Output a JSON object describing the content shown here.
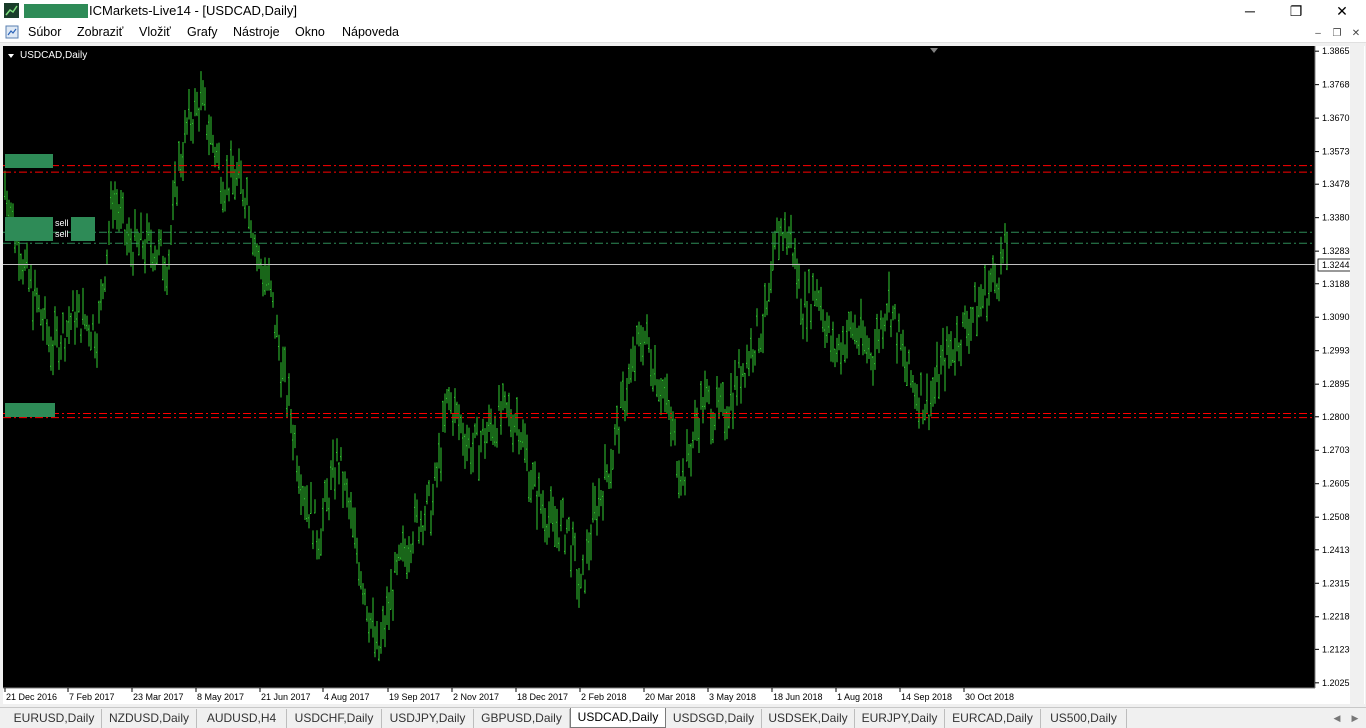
{
  "window": {
    "title": "ICMarkets-Live14 - [USDCAD,Daily]",
    "minimize_glyph": "─",
    "maximize_glyph": "❐",
    "close_glyph": "✕"
  },
  "menu": {
    "items": [
      "Súbor",
      "Zobraziť",
      "Vložiť",
      "Grafy",
      "Nástroje",
      "Okno",
      "Nápoveda"
    ],
    "mdi_minimize": "–",
    "mdi_restore": "❐",
    "mdi_close": "✕"
  },
  "chart": {
    "symbol_label": "USDCAD,Daily",
    "current_price": "1.32442",
    "colors": {
      "background": "#000000",
      "candles": "#32cd32",
      "grid_text": "#ffffff",
      "sell_lines": "#ff0000",
      "buy_lines": "#2e8b57",
      "price_line": "#c0c0c0",
      "label_box": "#2e8b57"
    },
    "order_labels": [
      "sell",
      "sell"
    ],
    "icons": [
      "chart-dropdown-arrow-icon",
      "app-logo-icon",
      "chart-window-icon"
    ]
  },
  "chart_data": {
    "type": "bar",
    "title": "USDCAD,Daily",
    "y_ticks": [
      "1.38655",
      "1.37680",
      "1.36705",
      "1.35730",
      "1.34780",
      "1.33805",
      "1.32830",
      "1.31880",
      "1.30905",
      "1.29930",
      "1.28955",
      "1.28005",
      "1.27030",
      "1.26055",
      "1.25080",
      "1.24130",
      "1.23155",
      "1.22180",
      "1.21230",
      "1.20255"
    ],
    "x_ticks": [
      "21 Dec 2016",
      "7 Feb 2017",
      "23 Mar 2017",
      "8 May 2017",
      "21 Jun 2017",
      "4 Aug 2017",
      "19 Sep 2017",
      "2 Nov 2017",
      "18 Dec 2017",
      "2 Feb 2018",
      "20 Mar 2018",
      "3 May 2018",
      "18 Jun 2018",
      "1 Aug 2018",
      "14 Sep 2018",
      "30 Oct 2018"
    ],
    "ylim": [
      1.2025,
      1.3866
    ],
    "path_points": [
      [
        0,
        1.35
      ],
      [
        25,
        1.32
      ],
      [
        50,
        1.3
      ],
      [
        72,
        1.31
      ],
      [
        95,
        1.305
      ],
      [
        110,
        1.345
      ],
      [
        125,
        1.33
      ],
      [
        150,
        1.33
      ],
      [
        165,
        1.325
      ],
      [
        175,
        1.352
      ],
      [
        185,
        1.365
      ],
      [
        198,
        1.372
      ],
      [
        210,
        1.36
      ],
      [
        222,
        1.348
      ],
      [
        232,
        1.35
      ],
      [
        245,
        1.345
      ],
      [
        255,
        1.325
      ],
      [
        265,
        1.32
      ],
      [
        280,
        1.293
      ],
      [
        300,
        1.26
      ],
      [
        315,
        1.245
      ],
      [
        335,
        1.268
      ],
      [
        355,
        1.24
      ],
      [
        375,
        1.21
      ],
      [
        390,
        1.23
      ],
      [
        410,
        1.248
      ],
      [
        430,
        1.255
      ],
      [
        445,
        1.285
      ],
      [
        470,
        1.27
      ],
      [
        495,
        1.28
      ],
      [
        515,
        1.28
      ],
      [
        530,
        1.26
      ],
      [
        550,
        1.248
      ],
      [
        565,
        1.248
      ],
      [
        578,
        1.228
      ],
      [
        590,
        1.25
      ],
      [
        610,
        1.27
      ],
      [
        625,
        1.29
      ],
      [
        640,
        1.305
      ],
      [
        660,
        1.288
      ],
      [
        680,
        1.262
      ],
      [
        700,
        1.285
      ],
      [
        720,
        1.28
      ],
      [
        740,
        1.295
      ],
      [
        765,
        1.31
      ],
      [
        775,
        1.335
      ],
      [
        788,
        1.332
      ],
      [
        800,
        1.312
      ],
      [
        815,
        1.318
      ],
      [
        830,
        1.298
      ],
      [
        850,
        1.306
      ],
      [
        870,
        1.298
      ],
      [
        885,
        1.315
      ],
      [
        905,
        1.292
      ],
      [
        925,
        1.283
      ],
      [
        940,
        1.296
      ],
      [
        960,
        1.305
      ],
      [
        980,
        1.315
      ],
      [
        995,
        1.322
      ],
      [
        1005,
        1.33
      ]
    ],
    "horizontal_lines": [
      {
        "name": "sell-line-1",
        "value": 1.3532,
        "color": "#ff0000"
      },
      {
        "name": "sell-line-2",
        "value": 1.3513,
        "color": "#ff0000"
      },
      {
        "name": "buy-line-1",
        "value": 1.3338,
        "color": "#2e8b57"
      },
      {
        "name": "buy-line-2",
        "value": 1.3306,
        "color": "#2e8b57"
      },
      {
        "name": "buy-line-3",
        "value": 1.281,
        "color": "#ff0000"
      },
      {
        "name": "buy-line-4",
        "value": 1.2798,
        "color": "#ff0000"
      },
      {
        "name": "current-price-line",
        "value": 1.32442,
        "color": "#c0c0c0"
      }
    ]
  },
  "tabs": {
    "items": [
      "EURUSD,Daily",
      "NZDUSD,Daily",
      "AUDUSD,H4",
      "USDCHF,Daily",
      "USDJPY,Daily",
      "GBPUSD,Daily",
      "USDCAD,Daily",
      "USDSGD,Daily",
      "USDSEK,Daily",
      "EURJPY,Daily",
      "EURCAD,Daily",
      "US500,Daily"
    ],
    "active_index": 6,
    "scroll_left": "◀",
    "scroll_right": "▶"
  }
}
